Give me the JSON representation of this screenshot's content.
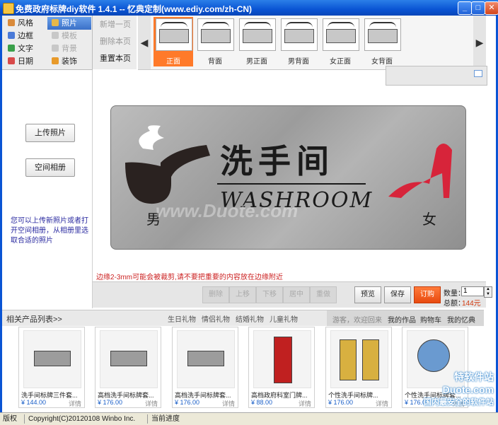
{
  "window": {
    "title": "免费政府标牌diy软件 1.4.1 -- 忆典定制(www.ediy.com/zh-CN)"
  },
  "tools": [
    {
      "label": "风格",
      "active": false,
      "disabled": false,
      "color": "#d98a3a"
    },
    {
      "label": "照片",
      "active": true,
      "disabled": false,
      "color": "#e6b84a"
    },
    {
      "label": "边框",
      "active": false,
      "disabled": false,
      "color": "#4a7ad8"
    },
    {
      "label": "模板",
      "active": false,
      "disabled": true,
      "color": "#c8c8c8"
    },
    {
      "label": "文字",
      "active": false,
      "disabled": false,
      "color": "#3aa04a"
    },
    {
      "label": "背景",
      "active": false,
      "disabled": true,
      "color": "#c8c8c8"
    },
    {
      "label": "日期",
      "active": false,
      "disabled": false,
      "color": "#d84a4a"
    },
    {
      "label": "装饰",
      "active": false,
      "disabled": false,
      "color": "#e89a2a"
    }
  ],
  "page_buttons": [
    {
      "label": "新增一页",
      "enabled": false
    },
    {
      "label": "删除本页",
      "enabled": false
    },
    {
      "label": "重置本页",
      "enabled": true
    }
  ],
  "thumbnails": [
    {
      "label": "正面",
      "selected": true
    },
    {
      "label": "背面",
      "selected": false
    },
    {
      "label": "男正面",
      "selected": false
    },
    {
      "label": "男背面",
      "selected": false
    },
    {
      "label": "女正面",
      "selected": false
    },
    {
      "label": "女背面",
      "selected": false
    }
  ],
  "side": {
    "upload_label": "上传照片",
    "album_label": "空间相册",
    "hint": "您可以上传新照片或者打开空间相册，从相册里选取合适的照片"
  },
  "plaque": {
    "title": "洗手间",
    "subtitle": "WASHROOM",
    "male": "男",
    "female": "女",
    "watermark": "www.Duote.com"
  },
  "warning": "边缘2-3mm可能会被裁剪,请不要把重要的内容放在边缘附近",
  "edit_buttons": [
    "删除",
    "上移",
    "下移",
    "居中",
    "重做"
  ],
  "actions": {
    "preview": "预览",
    "save": "保存",
    "order": "订购"
  },
  "order": {
    "qty_label": "数量：",
    "qty_value": "1",
    "total_label": "总额：",
    "total_value": "144元"
  },
  "related": {
    "title": "相关产品列表>>",
    "categories": [
      "生日礼物",
      "情侣礼物",
      "结婚礼物",
      "儿童礼物"
    ],
    "user_links": [
      "游客，欢迎回来",
      "我的作品",
      "购物车",
      "我的忆典"
    ]
  },
  "products": [
    {
      "name": "洗手间标牌三件套...",
      "price": "¥ 144.00",
      "detail": "详情"
    },
    {
      "name": "高档洗手间标牌套...",
      "price": "¥ 176.00",
      "detail": "详情"
    },
    {
      "name": "高档洗手间标牌套...",
      "price": "¥ 176.00",
      "detail": "详情"
    },
    {
      "name": "高档政府科室门牌...",
      "price": "¥ 88.00",
      "detail": "详情"
    },
    {
      "name": "个性洗手间标牌...",
      "price": "¥ 176.00",
      "detail": "详情"
    },
    {
      "name": "个性洗手间标牌套...",
      "price": "¥ 176.00",
      "detail": "详情"
    }
  ],
  "status": {
    "copyright_label": "版权",
    "copyright": "Copyright(C)20120108 Winbo Inc.",
    "progress_label": "当前进度"
  },
  "watermark_logo": {
    "line1": "特软件站",
    "line2": "Duote.com",
    "line3": "国内最安全的软件站"
  }
}
